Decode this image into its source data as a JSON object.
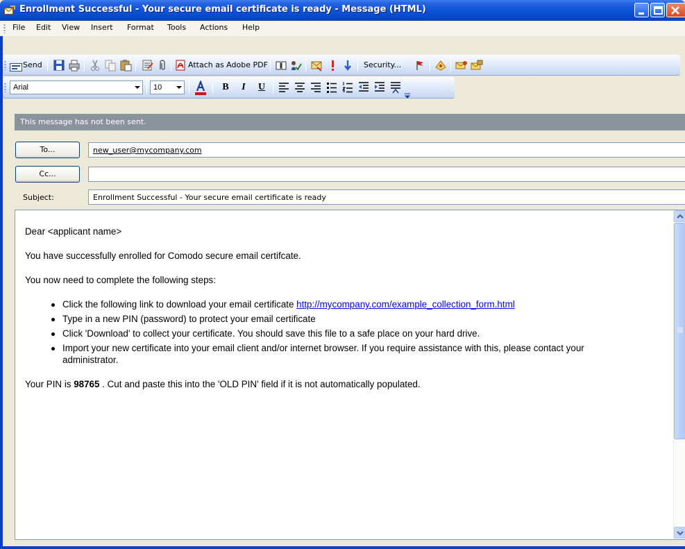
{
  "window": {
    "title": "Enrollment Successful - Your secure email certificate is ready - Message (HTML)"
  },
  "menu": {
    "items": [
      "File",
      "Edit",
      "View",
      "Insert",
      "Format",
      "Tools",
      "Actions",
      "Help"
    ]
  },
  "toolbar": {
    "send_label": "Send",
    "attach_pdf_label": "Attach as Adobe PDF",
    "security_label": "Security..."
  },
  "format_toolbar": {
    "font": "Arial",
    "size": "10"
  },
  "infobar": {
    "text": "This message has not been sent."
  },
  "header": {
    "to_button": "To...",
    "cc_button": "Cc...",
    "subject_label": "Subject:",
    "to_value": "new_user@mycompany.com",
    "cc_value": "",
    "subject_value": "Enrollment Successful - Your secure email certificate is ready"
  },
  "body": {
    "greeting": "Dear <applicant name>",
    "line1": "You have successfully enrolled for Comodo secure email certifcate.",
    "line2": "You now need to complete the following steps:",
    "step1_text": "Click the following link to download your email certificate ",
    "step1_link": "http://mycompany.com/example_collection_form.html",
    "step2": "Type in a new PIN (password) to protect your email certificate",
    "step3": "Click 'Download' to collect your certificate. You should save this file to a safe place on your hard drive.",
    "step4": "Import your new certificate into your email client and/or internet browser. If you require assistance with this, please contact your administrator.",
    "pin_prefix": "Your PIN is ",
    "pin": "98765",
    "pin_suffix": " . Cut and paste this into the 'OLD PIN' field if it is not automatically populated."
  }
}
